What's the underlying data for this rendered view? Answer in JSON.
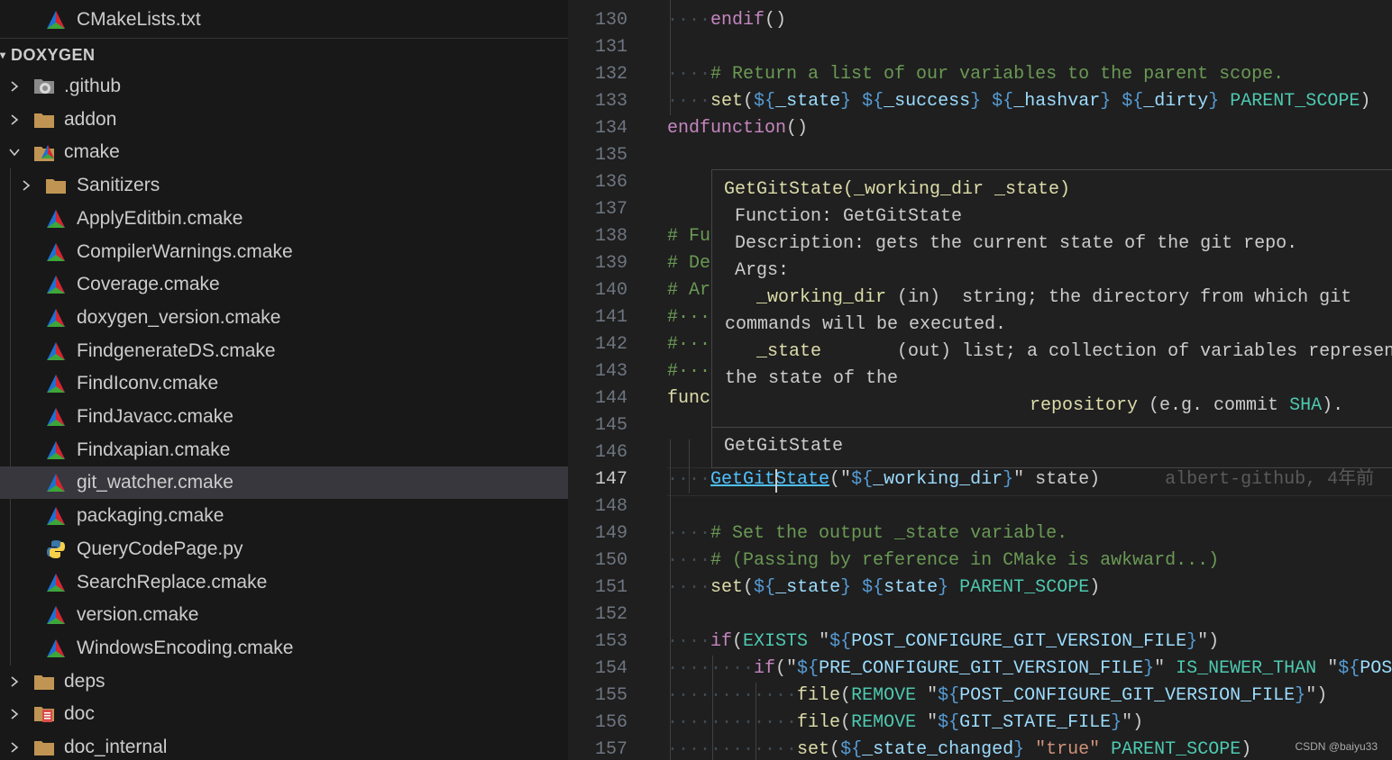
{
  "explorer": {
    "top_item": "CMakeLists.txt",
    "section_title": "DOXYGEN",
    "items": [
      {
        "label": ".github",
        "icon": "github-folder-icon",
        "level": 0,
        "expanded": false
      },
      {
        "label": "addon",
        "icon": "folder-icon",
        "level": 0,
        "expanded": false
      },
      {
        "label": "cmake",
        "icon": "cmake-folder-icon",
        "level": 0,
        "expanded": true
      },
      {
        "label": "Sanitizers",
        "icon": "folder-icon",
        "level": 1,
        "expanded": false
      },
      {
        "label": "ApplyEditbin.cmake",
        "icon": "cmake-file-icon",
        "level": 1
      },
      {
        "label": "CompilerWarnings.cmake",
        "icon": "cmake-file-icon",
        "level": 1
      },
      {
        "label": "Coverage.cmake",
        "icon": "cmake-file-icon",
        "level": 1
      },
      {
        "label": "doxygen_version.cmake",
        "icon": "cmake-file-icon",
        "level": 1
      },
      {
        "label": "FindgenerateDS.cmake",
        "icon": "cmake-file-icon",
        "level": 1
      },
      {
        "label": "FindIconv.cmake",
        "icon": "cmake-file-icon",
        "level": 1
      },
      {
        "label": "FindJavacc.cmake",
        "icon": "cmake-file-icon",
        "level": 1
      },
      {
        "label": "Findxapian.cmake",
        "icon": "cmake-file-icon",
        "level": 1
      },
      {
        "label": "git_watcher.cmake",
        "icon": "cmake-file-icon",
        "level": 1,
        "selected": true
      },
      {
        "label": "packaging.cmake",
        "icon": "cmake-file-icon",
        "level": 1
      },
      {
        "label": "QueryCodePage.py",
        "icon": "python-file-icon",
        "level": 1
      },
      {
        "label": "SearchReplace.cmake",
        "icon": "cmake-file-icon",
        "level": 1
      },
      {
        "label": "version.cmake",
        "icon": "cmake-file-icon",
        "level": 1
      },
      {
        "label": "WindowsEncoding.cmake",
        "icon": "cmake-file-icon",
        "level": 1
      },
      {
        "label": "deps",
        "icon": "folder-icon",
        "level": 0,
        "expanded": false
      },
      {
        "label": "doc",
        "icon": "doc-folder-icon",
        "level": 0,
        "expanded": false
      },
      {
        "label": "doc_internal",
        "icon": "folder-icon",
        "level": 0,
        "expanded": false
      }
    ]
  },
  "editor": {
    "active_line": 147,
    "lines": [
      {
        "n": "130",
        "segs": [
          [
            "····",
            "ws"
          ],
          [
            "endif",
            "kw2"
          ],
          [
            "()",
            ""
          ]
        ]
      },
      {
        "n": "131",
        "segs": []
      },
      {
        "n": "132",
        "segs": [
          [
            "····",
            "ws"
          ],
          [
            "# Return a list of our variables to the parent scope.",
            "cm"
          ]
        ]
      },
      {
        "n": "133",
        "segs": [
          [
            "····",
            "ws"
          ],
          [
            "set",
            "kw"
          ],
          [
            "(",
            ""
          ],
          [
            "${",
            "brace"
          ],
          [
            "_state",
            "var"
          ],
          [
            "}",
            "brace"
          ],
          [
            " ",
            ""
          ],
          [
            "${",
            "brace"
          ],
          [
            "_success",
            "var"
          ],
          [
            "}",
            "brace"
          ],
          [
            " ",
            ""
          ],
          [
            "${",
            "brace"
          ],
          [
            "_hashvar",
            "var"
          ],
          [
            "}",
            "brace"
          ],
          [
            " ",
            ""
          ],
          [
            "${",
            "brace"
          ],
          [
            "_dirty",
            "var"
          ],
          [
            "}",
            "brace"
          ],
          [
            " ",
            ""
          ],
          [
            "PARENT_SCOPE",
            "const"
          ],
          [
            ")",
            ""
          ]
        ]
      },
      {
        "n": "134",
        "segs": [
          [
            "endfunction",
            "kw2"
          ],
          [
            "()",
            ""
          ]
        ]
      },
      {
        "n": "135",
        "segs": []
      },
      {
        "n": "136",
        "segs": []
      },
      {
        "n": "137",
        "segs": []
      },
      {
        "n": "138",
        "segs": [
          [
            "# Fu",
            "cm"
          ]
        ]
      },
      {
        "n": "139",
        "segs": [
          [
            "# De",
            "cm"
          ]
        ]
      },
      {
        "n": "140",
        "segs": [
          [
            "# Ar",
            "cm"
          ]
        ]
      },
      {
        "n": "141",
        "segs": [
          [
            "#···",
            "cm"
          ]
        ]
      },
      {
        "n": "142",
        "segs": [
          [
            "#···",
            "cm"
          ]
        ]
      },
      {
        "n": "143",
        "segs": [
          [
            "#···",
            "cm"
          ]
        ]
      },
      {
        "n": "144",
        "segs": [
          [
            "func",
            "kw"
          ]
        ]
      },
      {
        "n": "145",
        "segs": []
      },
      {
        "n": "146",
        "segs": []
      },
      {
        "n": "147",
        "segs": [
          [
            "····",
            "ws"
          ],
          [
            "GetGitState",
            "link"
          ],
          [
            "(\"",
            ""
          ],
          [
            "${",
            "brace"
          ],
          [
            "_working_dir",
            "var"
          ],
          [
            "}",
            "brace"
          ],
          [
            "\" state)",
            ""
          ],
          [
            "      albert-github, 4年前 ",
            "blame"
          ]
        ]
      },
      {
        "n": "148",
        "segs": []
      },
      {
        "n": "149",
        "segs": [
          [
            "····",
            "ws"
          ],
          [
            "# Set the output _state variable.",
            "cm"
          ]
        ]
      },
      {
        "n": "150",
        "segs": [
          [
            "····",
            "ws"
          ],
          [
            "# (Passing by reference in CMake is awkward...)",
            "cm"
          ]
        ]
      },
      {
        "n": "151",
        "segs": [
          [
            "····",
            "ws"
          ],
          [
            "set",
            "kw"
          ],
          [
            "(",
            ""
          ],
          [
            "${",
            "brace"
          ],
          [
            "_state",
            "var"
          ],
          [
            "}",
            "brace"
          ],
          [
            " ",
            ""
          ],
          [
            "${",
            "brace"
          ],
          [
            "state",
            "var"
          ],
          [
            "}",
            "brace"
          ],
          [
            " ",
            ""
          ],
          [
            "PARENT_SCOPE",
            "const"
          ],
          [
            ")",
            ""
          ]
        ]
      },
      {
        "n": "152",
        "segs": []
      },
      {
        "n": "153",
        "segs": [
          [
            "····",
            "ws"
          ],
          [
            "if",
            "kw2"
          ],
          [
            "(",
            ""
          ],
          [
            "EXISTS",
            "const"
          ],
          [
            " \"",
            ""
          ],
          [
            "${",
            "brace"
          ],
          [
            "POST_CONFIGURE_GIT_VERSION_FILE",
            "var"
          ],
          [
            "}",
            "brace"
          ],
          [
            "\")",
            ""
          ]
        ]
      },
      {
        "n": "154",
        "segs": [
          [
            "········",
            "ws"
          ],
          [
            "if",
            "kw2"
          ],
          [
            "(\"",
            ""
          ],
          [
            "${",
            "brace"
          ],
          [
            "PRE_CONFIGURE_GIT_VERSION_FILE",
            "var"
          ],
          [
            "}",
            "brace"
          ],
          [
            "\" ",
            ""
          ],
          [
            "IS_NEWER_THAN",
            "const"
          ],
          [
            " \"",
            ""
          ],
          [
            "${",
            "brace"
          ],
          [
            "POS",
            "var"
          ]
        ]
      },
      {
        "n": "155",
        "segs": [
          [
            "············",
            "ws"
          ],
          [
            "file",
            "kw"
          ],
          [
            "(",
            ""
          ],
          [
            "REMOVE",
            "const"
          ],
          [
            " \"",
            ""
          ],
          [
            "${",
            "brace"
          ],
          [
            "POST_CONFIGURE_GIT_VERSION_FILE",
            "var"
          ],
          [
            "}",
            "brace"
          ],
          [
            "\")",
            ""
          ]
        ]
      },
      {
        "n": "156",
        "segs": [
          [
            "············",
            "ws"
          ],
          [
            "file",
            "kw"
          ],
          [
            "(",
            ""
          ],
          [
            "REMOVE",
            "const"
          ],
          [
            " \"",
            ""
          ],
          [
            "${",
            "brace"
          ],
          [
            "GIT_STATE_FILE",
            "var"
          ],
          [
            "}",
            "brace"
          ],
          [
            "\")",
            ""
          ]
        ]
      },
      {
        "n": "157",
        "segs": [
          [
            "············",
            "ws"
          ],
          [
            "set",
            "kw"
          ],
          [
            "(",
            ""
          ],
          [
            "${",
            "brace"
          ],
          [
            "_state_changed",
            "var"
          ],
          [
            "}",
            "brace"
          ],
          [
            " ",
            ""
          ],
          [
            "\"true\"",
            "str"
          ],
          [
            " ",
            ""
          ],
          [
            "PARENT_SCOPE",
            "const"
          ],
          [
            ")",
            ""
          ]
        ]
      }
    ]
  },
  "hover": {
    "signature": "GetGitState(_working_dir _state)",
    "function_line": "Function: GetGitState",
    "description_line": "Description: gets the current state of the git repo.",
    "args_label": "Args:",
    "arg1_name": "_working_dir",
    "arg1_rest": " (in)  string; the directory from which git",
    "arg1_cont": "commands will be executed.",
    "arg2_name": "_state",
    "arg2_rest": "       (out) list; a collection of variables represen",
    "arg2_cont": "the state of the",
    "repo_word": "repository",
    "repo_mid": " (e.g. commit ",
    "repo_sha": "SHA",
    "repo_end": ").",
    "footer": "GetGitState"
  },
  "watermark": "CSDN @baiyu33"
}
